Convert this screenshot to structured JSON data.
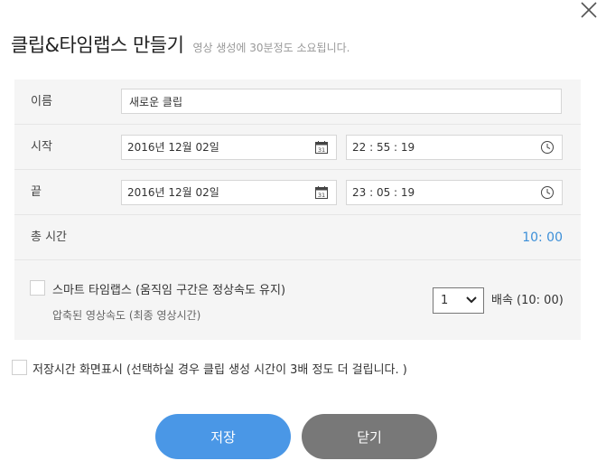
{
  "dialog": {
    "title": "클립&타임랩스 만들기",
    "subtitle": "영상 생성에 30분정도 소요됩니다."
  },
  "form": {
    "name": {
      "label": "이름",
      "value": "새로운 클립"
    },
    "start": {
      "label": "시작",
      "date": "2016년 12월 02일",
      "time": "22 : 55 : 19"
    },
    "end": {
      "label": "끝",
      "date": "2016년 12월 02일",
      "time": "23 : 05 : 19"
    },
    "total": {
      "label": "총 시간",
      "value": "10: 00"
    },
    "timelapse": {
      "label": "스마트 타임랩스  (움직임 구간은 정상속도 유지)",
      "sublabel": "압축된 영상속도 (최종 영상시간)",
      "speed_selected": "1",
      "speed_text": "배속 (10: 00)",
      "checked": false
    },
    "storage_display": {
      "label": "저장시간 화면표시 (선택하실 경우 클립 생성 시간이 3배 정도 더 걸립니다. )",
      "checked": false
    }
  },
  "buttons": {
    "save": "저장",
    "close": "닫기"
  },
  "icons": {
    "close": "close-icon",
    "calendar": "calendar-icon",
    "calendar_day": "31",
    "clock": "clock-icon",
    "dropdown": "chevron-down-icon"
  },
  "colors": {
    "accent": "#4a97e6",
    "duration": "#3c8fd8",
    "secondary_button": "#787878"
  }
}
